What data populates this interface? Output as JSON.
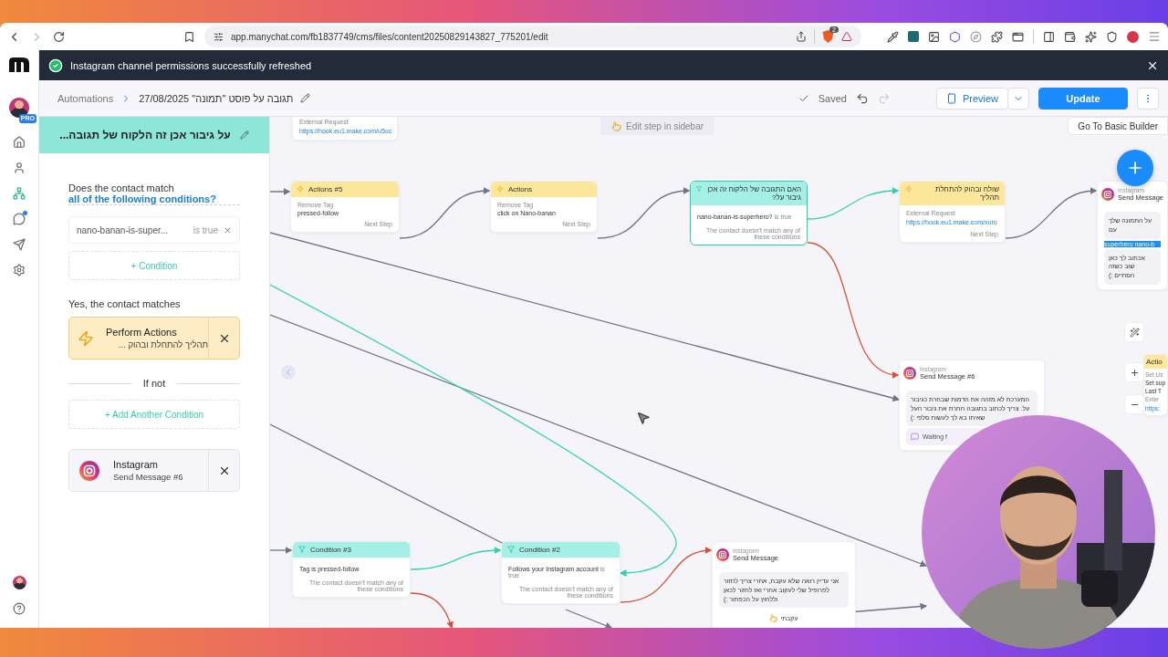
{
  "browser": {
    "url": "app.manychat.com/fb1837749/cms/files/content20250829143827_775201/edit",
    "shield_count": "2"
  },
  "notification": {
    "text": "Instagram channel permissions successfully refreshed"
  },
  "nav": {
    "badge": "PRO",
    "items": [
      {
        "kind": "home",
        "selected": false,
        "unread": false
      },
      {
        "kind": "contacts",
        "selected": false,
        "unread": false
      },
      {
        "kind": "automation",
        "selected": true,
        "unread": false
      },
      {
        "kind": "chat",
        "selected": false,
        "unread": true
      },
      {
        "kind": "broadcast",
        "selected": false,
        "unread": false
      },
      {
        "kind": "settings",
        "selected": false,
        "unread": false
      }
    ]
  },
  "header": {
    "breadcrumb": [
      "Automations",
      "תגובה על פוסט \"תמונה\" 27/08/2025"
    ],
    "status": "Saved",
    "preview": "Preview",
    "update": "Update"
  },
  "panel": {
    "title": "על גיבור אכן זה הלקוח של תגובה...",
    "question": "Does the contact match",
    "match_mode": "all of the following conditions?",
    "conditions": [
      {
        "field": "nano-banan-is-super...",
        "operator": "is true"
      }
    ],
    "add_condition": "+ Condition",
    "yes_label": "Yes, the contact matches",
    "yes_step": {
      "kind": "actions",
      "title": "Perform Actions",
      "subtitle": "תהליך להתחלת ובהוק ..."
    },
    "divider": "If not",
    "add_another": "+ Add Another Condition",
    "no_step": {
      "kind": "instagram",
      "title": "Instagram",
      "subtitle": "Send Message #6"
    }
  },
  "canvas": {
    "hint": "Edit step in sidebar",
    "basic_builder": "Go To Basic Builder",
    "nodes": [
      {
        "kind": "plain",
        "selected": false,
        "items": [
          {
            "kind": "caption",
            "text": "External Request"
          },
          {
            "kind": "link",
            "text": "https://hook.eu1.make.com/u5oc"
          }
        ]
      },
      {
        "kind": "actions",
        "title": "Actions #5",
        "selected": false,
        "next": "Next Step",
        "items": [
          {
            "kind": "caption",
            "text": "Remove Tag"
          },
          {
            "kind": "value",
            "text": "pressed-follow"
          }
        ]
      },
      {
        "kind": "actions",
        "title": "Actions",
        "selected": false,
        "next": "Next Step",
        "items": [
          {
            "kind": "caption",
            "text": "Remove Tag"
          },
          {
            "kind": "value",
            "text": "click  on  Nano-banan"
          }
        ]
      },
      {
        "kind": "condition",
        "title": "האם התגובה של הלקוח זה אכן גיבור על?",
        "selected": true,
        "items": [
          {
            "kind": "condition",
            "text": "nano-banan-is-superhero?",
            "suffix": "is true"
          },
          {
            "kind": "fallback",
            "text": "The contact doesn't match any of these conditions"
          }
        ]
      },
      {
        "kind": "actions",
        "title": "שולח ובהוק להתחלת תהליך",
        "selected": false,
        "next": "Next Step",
        "items": [
          {
            "kind": "caption",
            "text": "External Request"
          },
          {
            "kind": "link",
            "text": "https://hook.eu1.make.com/xuro"
          }
        ]
      },
      {
        "kind": "instagram",
        "platform": "Instagram",
        "title": "Send Message",
        "selected": false,
        "items": [
          {
            "kind": "bubble",
            "text": "על התמונה שלך עם"
          },
          {
            "kind": "highlight",
            "text": "superhero nano-b"
          },
          {
            "kind": "bubble",
            "text": "אכתוב לך כאן שוב כשזה הסתיים :)"
          }
        ]
      },
      {
        "kind": "instagram",
        "platform": "Instagram",
        "title": "Send Message #6",
        "selected": false,
        "items": [
          {
            "kind": "bubble",
            "text": "המערכת לא מזהה את הדמות שבחרת כגיבור על. צריך לכתוב בתגובה חחרת את גיבור העל שאיתו בא לך לעשות סלפי :)"
          },
          {
            "kind": "waiting",
            "text": "Waiting f"
          }
        ]
      },
      {
        "kind": "actions",
        "title": "Actio",
        "selected": false,
        "items": [
          {
            "kind": "caption",
            "text": "Set Us"
          },
          {
            "kind": "value",
            "text": "Set sup"
          },
          {
            "kind": "value",
            "text": "Last T"
          },
          {
            "kind": "caption",
            "text": "Exter"
          },
          {
            "kind": "link",
            "text": "https:"
          }
        ]
      },
      {
        "kind": "condition",
        "title": "Condition #3",
        "selected": false,
        "items": [
          {
            "kind": "condition",
            "text": "Tag is pressed-follow"
          },
          {
            "kind": "fallback",
            "text": "The contact doesn't match any of these conditions"
          }
        ]
      },
      {
        "kind": "condition",
        "title": "Condition #2",
        "selected": false,
        "items": [
          {
            "kind": "condition",
            "text": "Follows your Instagram account",
            "suffix": "is true"
          },
          {
            "kind": "fallback",
            "text": "The contact doesn't match any of these conditions"
          }
        ]
      },
      {
        "kind": "instagram",
        "platform": "Instagram",
        "title": "Send Message",
        "selected": false,
        "items": [
          {
            "kind": "bubble",
            "text": "אני עדיין רואה שלא עקבת, אחרי צריך לחזור לפרופיל שלי לעקוב אחרי ואז לחזור לכאן וללחוץ על הכפתור :)"
          },
          {
            "kind": "button",
            "text": "עקבתי"
          }
        ]
      }
    ]
  }
}
